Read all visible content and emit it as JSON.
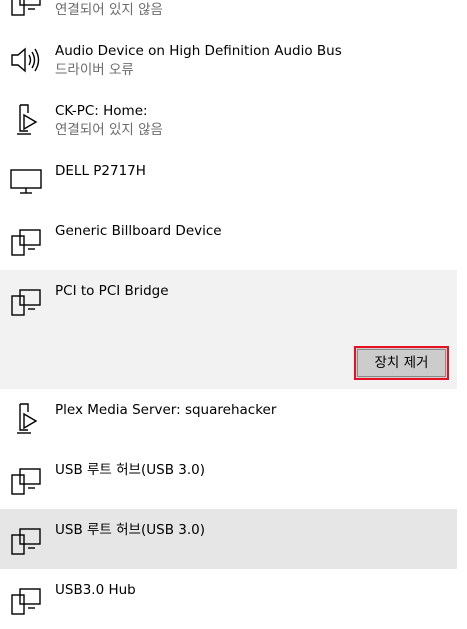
{
  "devices": [
    {
      "name": "",
      "status": "연결되어 있지 않음",
      "icon": "computer-device-icon"
    },
    {
      "name": "Audio Device on High Definition Audio Bus",
      "status": "드라이버 오류",
      "icon": "speaker-icon"
    },
    {
      "name": "CK-PC: Home:",
      "status": "연결되어 있지 않음",
      "icon": "media-device-icon"
    },
    {
      "name": "DELL P2717H",
      "status": "",
      "icon": "monitor-icon"
    },
    {
      "name": "Generic Billboard Device",
      "status": "",
      "icon": "generic-device-icon"
    },
    {
      "name": "PCI to PCI Bridge",
      "status": "",
      "icon": "generic-device-icon"
    },
    {
      "name": "Plex Media Server: squarehacker",
      "status": "",
      "icon": "media-device-icon"
    },
    {
      "name": "USB 루트 허브(USB 3.0)",
      "status": "",
      "icon": "generic-device-icon"
    },
    {
      "name": "USB 루트 허브(USB 3.0)",
      "status": "",
      "icon": "generic-device-icon"
    },
    {
      "name": "USB3.0 Hub",
      "status": "",
      "icon": "generic-device-icon"
    }
  ],
  "selected_panel": {
    "remove_button_label": "장치 제거"
  },
  "colors": {
    "selected_background": "#f2f2f2",
    "hover_background": "#e6e6e6",
    "button_background": "#cccccc",
    "button_focus_border": "#e81123",
    "secondary_text": "#6b6b6b"
  }
}
